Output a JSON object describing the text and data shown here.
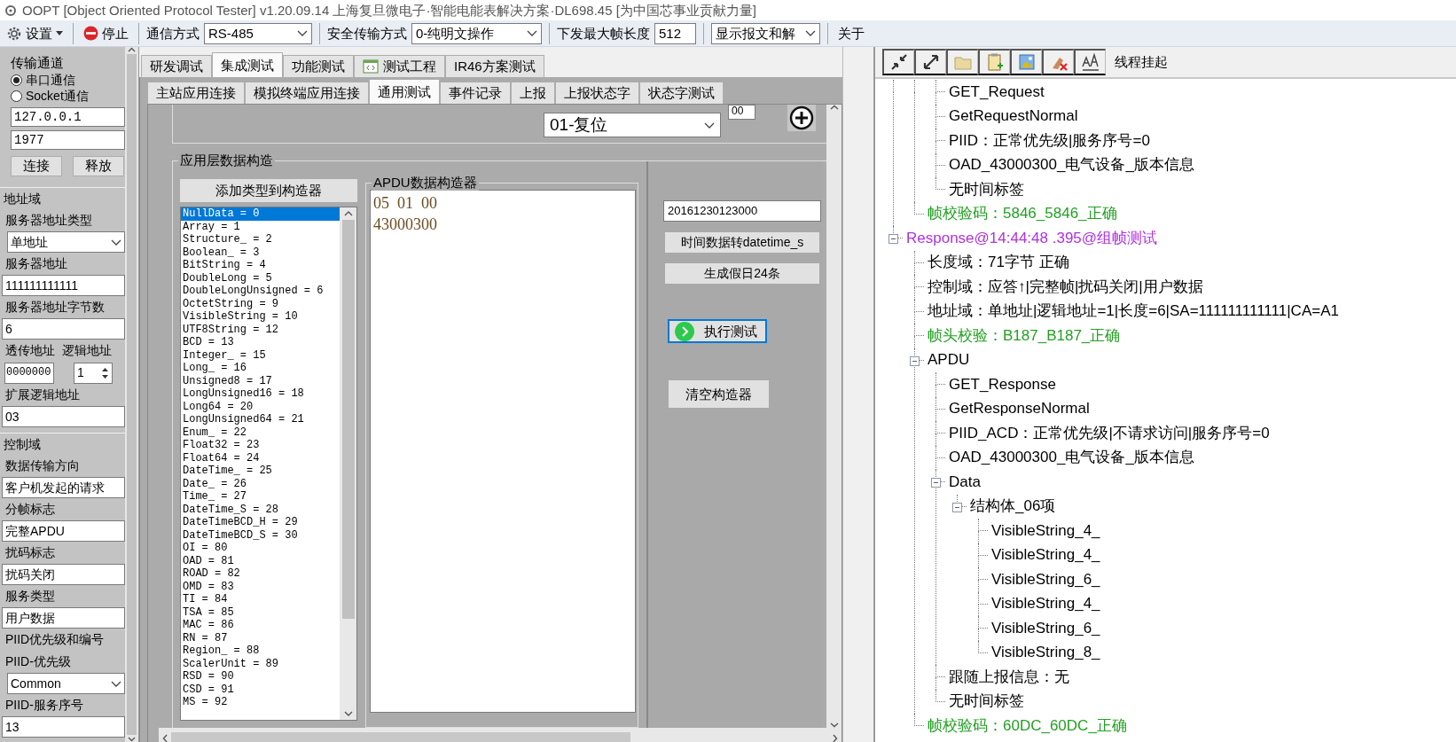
{
  "window": {
    "title": "OOPT [Object Oriented Protocol Tester] v1.20.09.14 上海复旦微电子·智能电能表解决方案·DL698.45 [为中国芯事业贡献力量]"
  },
  "toolbar": [
    {
      "kind": "menu",
      "text": "设置"
    },
    {
      "kind": "stop",
      "text": "停止"
    },
    {
      "kind": "label",
      "text": "通信方式"
    },
    {
      "kind": "select",
      "value": "RS-485"
    },
    {
      "kind": "label",
      "text": "安全传输方式"
    },
    {
      "kind": "select",
      "value": "0-纯明文操作"
    },
    {
      "kind": "label",
      "text": "下发最大帧长度"
    },
    {
      "kind": "input",
      "value": "512"
    },
    {
      "kind": "select",
      "value": "显示报文和解"
    },
    {
      "kind": "button",
      "text": "关于"
    }
  ],
  "left_panel": {
    "items": [
      {
        "kind": "group_title",
        "text": "传输通道"
      },
      {
        "kind": "radio",
        "label": "串口通信",
        "selected": true
      },
      {
        "kind": "radio",
        "label": "Socket通信",
        "selected": false
      },
      {
        "kind": "input",
        "value": "127.0.0.1"
      },
      {
        "kind": "input",
        "value": "1977"
      },
      {
        "kind": "buttons",
        "labels": [
          "连接",
          "释放"
        ]
      },
      {
        "kind": "section",
        "text": "地址域"
      },
      {
        "kind": "label",
        "text": "服务器地址类型"
      },
      {
        "kind": "select",
        "value": "单地址"
      },
      {
        "kind": "label",
        "text": "服务器地址"
      },
      {
        "kind": "input",
        "value": "111111111111"
      },
      {
        "kind": "label",
        "text": "服务器地址字节数"
      },
      {
        "kind": "input",
        "value": "6"
      },
      {
        "kind": "label_pair",
        "texts": [
          "透传地址",
          "逻辑地址"
        ]
      },
      {
        "kind": "input_pair",
        "value": "0000000",
        "spin_value": "1"
      },
      {
        "kind": "label",
        "text": "扩展逻辑地址"
      },
      {
        "kind": "input",
        "value": "03"
      },
      {
        "kind": "section",
        "text": "控制域"
      },
      {
        "kind": "label",
        "text": "数据传输方向"
      },
      {
        "kind": "input",
        "value": "客户机发起的请求"
      },
      {
        "kind": "label",
        "text": "分帧标志"
      },
      {
        "kind": "input",
        "value": "完整APDU"
      },
      {
        "kind": "label",
        "text": "扰码标志"
      },
      {
        "kind": "input",
        "value": "扰码关闭"
      },
      {
        "kind": "label",
        "text": "服务类型"
      },
      {
        "kind": "input",
        "value": "用户数据"
      },
      {
        "kind": "label",
        "text": "PIID优先级和编号"
      },
      {
        "kind": "label",
        "text": "PIID-优先级"
      },
      {
        "kind": "select",
        "value": "Common"
      },
      {
        "kind": "label",
        "text": "PIID-服务序号"
      },
      {
        "kind": "input",
        "value": "13"
      }
    ]
  },
  "tabs": [
    {
      "label": "研发调试",
      "selected": false,
      "kind": "plain"
    },
    {
      "label": "集成测试",
      "selected": true,
      "kind": "plain"
    },
    {
      "label": "功能测试",
      "selected": false,
      "kind": "plain"
    },
    {
      "label": "测试工程",
      "selected": false,
      "kind": "icon"
    },
    {
      "label": "IR46方案测试",
      "selected": false,
      "kind": "plain"
    }
  ],
  "subtabs": [
    {
      "label": "主站应用连接",
      "selected": false
    },
    {
      "label": "模拟终端应用连接",
      "selected": false
    },
    {
      "label": "通用测试",
      "selected": true
    },
    {
      "label": "事件记录",
      "selected": false
    },
    {
      "label": "上报",
      "selected": false
    },
    {
      "label": "上报状态字",
      "selected": false
    },
    {
      "label": "状态字测试",
      "selected": false
    }
  ],
  "general_test": {
    "reset_select": "01-复位",
    "small_input": "00",
    "builder": {
      "title": "应用层数据构造",
      "add_button": "添加类型到构造器",
      "types": [
        {
          "label": "NullData = 0",
          "selected": true
        },
        {
          "label": "Array = 1",
          "selected": false
        },
        {
          "label": "Structure_ = 2",
          "selected": false
        },
        {
          "label": "Boolean_ = 3",
          "selected": false
        },
        {
          "label": "BitString = 4",
          "selected": false
        },
        {
          "label": "DoubleLong = 5",
          "selected": false
        },
        {
          "label": "DoubleLongUnsigned = 6",
          "selected": false
        },
        {
          "label": "OctetString = 9",
          "selected": false
        },
        {
          "label": "VisibleString = 10",
          "selected": false
        },
        {
          "label": "UTF8String = 12",
          "selected": false
        },
        {
          "label": "BCD = 13",
          "selected": false
        },
        {
          "label": "Integer_ = 15",
          "selected": false
        },
        {
          "label": "Long_ = 16",
          "selected": false
        },
        {
          "label": "Unsigned8 = 17",
          "selected": false
        },
        {
          "label": "LongUnsigned16 = 18",
          "selected": false
        },
        {
          "label": "Long64 = 20",
          "selected": false
        },
        {
          "label": "LongUnsigned64 = 21",
          "selected": false
        },
        {
          "label": "Enum_ = 22",
          "selected": false
        },
        {
          "label": "Float32 = 23",
          "selected": false
        },
        {
          "label": "Float64 = 24",
          "selected": false
        },
        {
          "label": "DateTime_ = 25",
          "selected": false
        },
        {
          "label": "Date_ = 26",
          "selected": false
        },
        {
          "label": "Time_ = 27",
          "selected": false
        },
        {
          "label": "DateTime_S = 28",
          "selected": false
        },
        {
          "label": "DateTimeBCD_H = 29",
          "selected": false
        },
        {
          "label": "DateTimeBCD_S = 30",
          "selected": false
        },
        {
          "label": "OI = 80",
          "selected": false
        },
        {
          "label": "OAD = 81",
          "selected": false
        },
        {
          "label": "ROAD = 82",
          "selected": false
        },
        {
          "label": "OMD = 83",
          "selected": false
        },
        {
          "label": "TI = 84",
          "selected": false
        },
        {
          "label": "TSA = 85",
          "selected": false
        },
        {
          "label": "MAC = 86",
          "selected": false
        },
        {
          "label": "RN = 87",
          "selected": false
        },
        {
          "label": "Region_ = 88",
          "selected": false
        },
        {
          "label": "ScalerUnit = 89",
          "selected": false
        },
        {
          "label": "RSD = 90",
          "selected": false
        },
        {
          "label": "CSD = 91",
          "selected": false
        },
        {
          "label": "MS = 92",
          "selected": false
        }
      ],
      "apdu_title": "APDU数据构造器",
      "apdu_lines": [
        "05  01  00",
        "43000300"
      ],
      "time_input": "20161230123000",
      "buttons": [
        {
          "label": "时间数据转datetime_s",
          "kind": "plain"
        },
        {
          "label": "生成假日24条",
          "kind": "plain"
        },
        {
          "label": "执行测试",
          "kind": "run"
        },
        {
          "label": "清空构造器",
          "kind": "plain"
        }
      ]
    }
  },
  "log_toolbar": {
    "label": "线程挂起"
  },
  "tree": [
    {
      "children": [
        {
          "children": [
            {
              "label": "GET_Request"
            },
            {
              "label": "GetRequestNormal"
            },
            {
              "label": "PIID：正常优先级|服务序号=0"
            },
            {
              "label": "OAD_43000300_电气设备_版本信息"
            },
            {
              "label": "无时间标签"
            }
          ]
        },
        {
          "label": "帧校验码：5846_5846_正确",
          "color": "#22a022"
        }
      ]
    },
    {
      "label": "Response@14:44:48 .395@组帧测试",
      "color": "#b030e0",
      "expanded": true,
      "children": [
        {
          "label": "长度域：71字节 正确"
        },
        {
          "label": "控制域：应答↑|完整帧|扰码关闭|用户数据"
        },
        {
          "label": "地址域：单地址|逻辑地址=1|长度=6|SA=111111111111|CA=A1"
        },
        {
          "label": "帧头校验：B187_B187_正确",
          "color": "#22a022"
        },
        {
          "label": "APDU",
          "expanded": true,
          "children": [
            {
              "label": "GET_Response"
            },
            {
              "label": "GetResponseNormal"
            },
            {
              "label": "PIID_ACD：正常优先级|不请求访问|服务序号=0"
            },
            {
              "label": "OAD_43000300_电气设备_版本信息"
            },
            {
              "label": "Data",
              "expanded": true,
              "children": [
                {
                  "label": "结构体_06项",
                  "expanded": true,
                  "children": [
                    {
                      "label": "VisibleString_4_"
                    },
                    {
                      "label": "VisibleString_4_"
                    },
                    {
                      "label": "VisibleString_6_"
                    },
                    {
                      "label": "VisibleString_4_"
                    },
                    {
                      "label": "VisibleString_6_"
                    },
                    {
                      "label": "VisibleString_8_"
                    }
                  ]
                }
              ]
            },
            {
              "label": "跟随上报信息：无"
            },
            {
              "label": "无时间标签"
            }
          ]
        },
        {
          "label": "帧校验码：60DC_60DC_正确",
          "color": "#22a022"
        }
      ]
    }
  ]
}
